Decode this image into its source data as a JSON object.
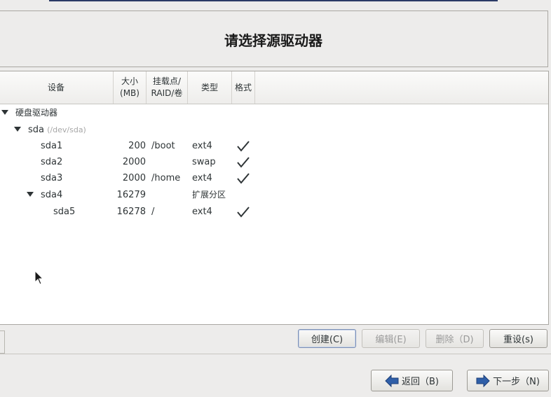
{
  "title": "请选择源驱动器",
  "columns": {
    "device": "设备",
    "size": "大小\n(MB)",
    "mount": "挂载点/\nRAID/卷",
    "type": "类型",
    "format": "格式"
  },
  "tree": {
    "group_label": "硬盘驱动器",
    "disk_name": "sda",
    "disk_path": "(/dev/sda)",
    "partitions": [
      {
        "name": "sda1",
        "size": "200",
        "mount": "/boot",
        "type": "ext4",
        "format": true
      },
      {
        "name": "sda2",
        "size": "2000",
        "mount": "",
        "type": "swap",
        "format": true
      },
      {
        "name": "sda3",
        "size": "2000",
        "mount": "/home",
        "type": "ext4",
        "format": true
      },
      {
        "name": "sda4",
        "size": "16279",
        "mount": "",
        "type": "扩展分区",
        "format": false
      },
      {
        "name": "sda5",
        "size": "16278",
        "mount": "/",
        "type": "ext4",
        "format": true
      }
    ]
  },
  "actions": {
    "create": "创建(C)",
    "edit": "编辑(E)",
    "delete": "删除（D)",
    "reset": "重设(s)"
  },
  "nav": {
    "back": "返回（B)",
    "next": "下一步（N)"
  },
  "colors": {
    "background": "#edeceb",
    "title_bar_accent": "#2b3a66",
    "arrow_blue": "#2f5fa8"
  }
}
